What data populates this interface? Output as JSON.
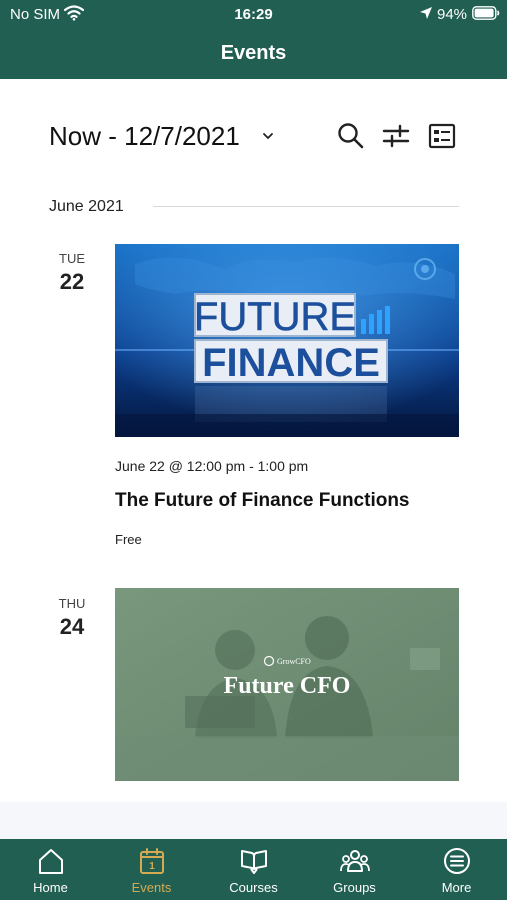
{
  "status": {
    "carrier": "No SIM",
    "time": "16:29",
    "battery": "94%"
  },
  "nav": {
    "title": "Events"
  },
  "filter": {
    "range": "Now - 12/7/2021"
  },
  "month": "June 2021",
  "events": [
    {
      "dow": "TUE",
      "dom": "22",
      "image_word1": "FUTURE",
      "image_word2": "FINANCE",
      "time": "June 22 @ 12:00 pm - 1:00 pm",
      "title": "The Future of Finance Functions",
      "price": "Free"
    },
    {
      "dow": "THU",
      "dom": "24",
      "image_brand": "GrowCFO",
      "image_title": "Future CFO"
    }
  ],
  "tabs": [
    {
      "label": "Home",
      "icon": "home-icon"
    },
    {
      "label": "Events",
      "icon": "calendar-icon",
      "active": true
    },
    {
      "label": "Courses",
      "icon": "book-icon"
    },
    {
      "label": "Groups",
      "icon": "groups-icon"
    },
    {
      "label": "More",
      "icon": "more-icon"
    }
  ],
  "colors": {
    "brand": "#205f52",
    "active_tab": "#d4ab53"
  }
}
